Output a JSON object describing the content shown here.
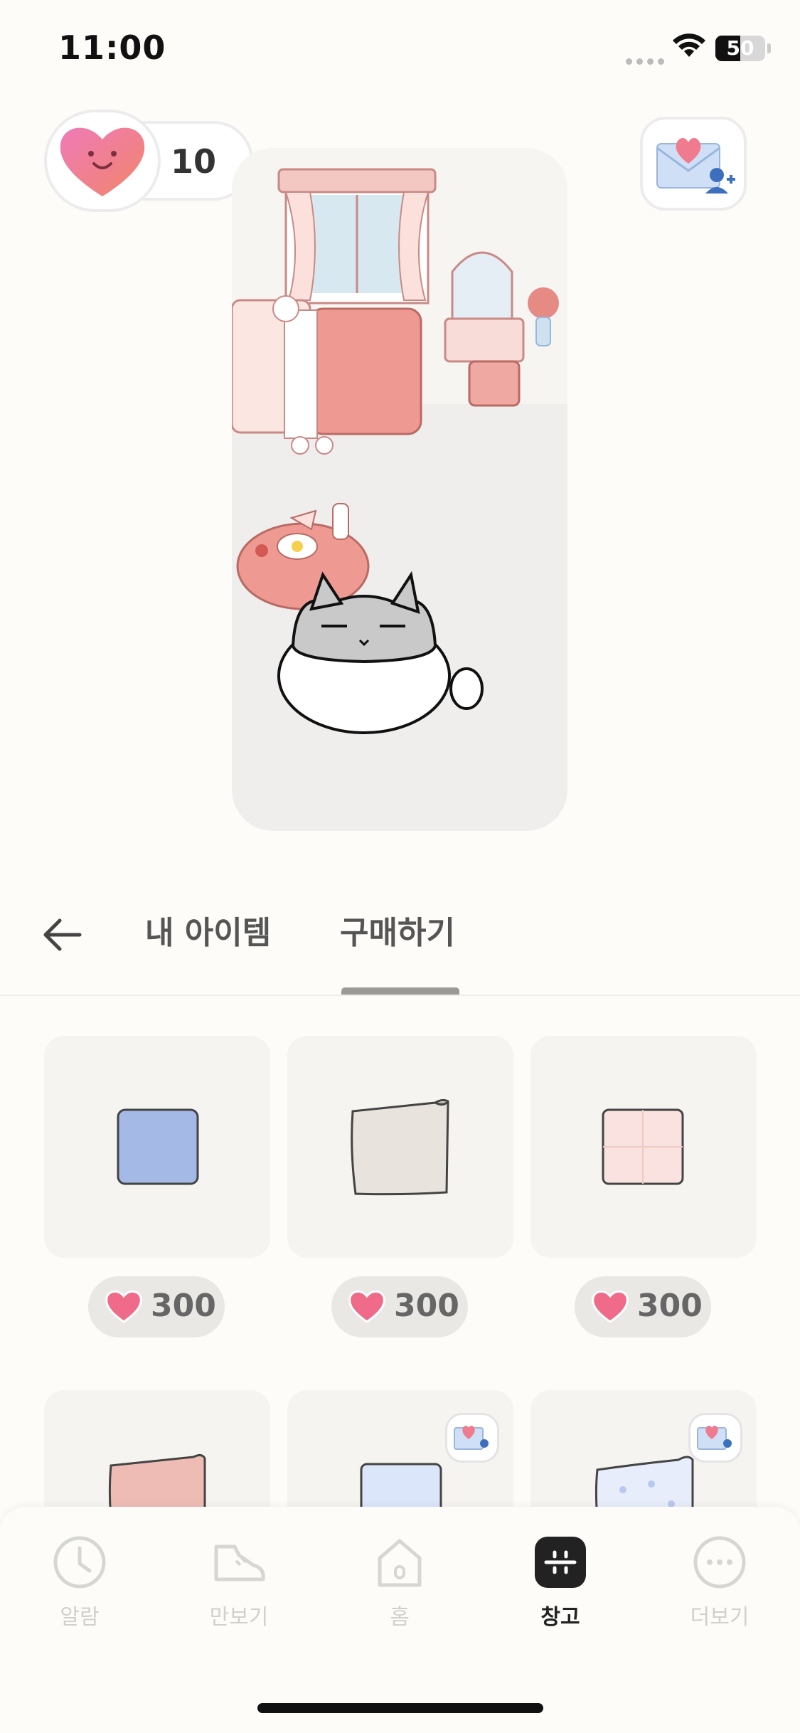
{
  "status_bar": {
    "time": "11:00",
    "battery": "50",
    "battery_level": 0.5
  },
  "currency": {
    "hearts": "10"
  },
  "tabs": [
    {
      "label": "내 아이템",
      "active": false
    },
    {
      "label": "구매하기",
      "active": true
    }
  ],
  "items": [
    {
      "name": "blue-pillow",
      "price": "300",
      "color": "#a4b9e6"
    },
    {
      "name": "beige-pillow",
      "price": "300",
      "color": "#e8e3dc"
    },
    {
      "name": "pink-pillow",
      "price": "300",
      "color": "#f9e2e0"
    },
    {
      "name": "rose-pillow",
      "price": "",
      "color": "#eebcb4"
    },
    {
      "name": "sky-pillow",
      "price": "",
      "color": "#dbe6fb"
    },
    {
      "name": "dot-pillow",
      "price": "",
      "color": "#e7edfb"
    }
  ],
  "nav": [
    {
      "label": "알람",
      "icon": "clock-icon"
    },
    {
      "label": "만보기",
      "icon": "shoe-icon"
    },
    {
      "label": "홈",
      "icon": "home-icon"
    },
    {
      "label": "창고",
      "icon": "storage-icon",
      "active": true
    },
    {
      "label": "더보기",
      "icon": "more-icon"
    }
  ],
  "colors": {
    "heart": "#f06a8a",
    "background": "#fdfcf8",
    "accent": "#222222"
  }
}
